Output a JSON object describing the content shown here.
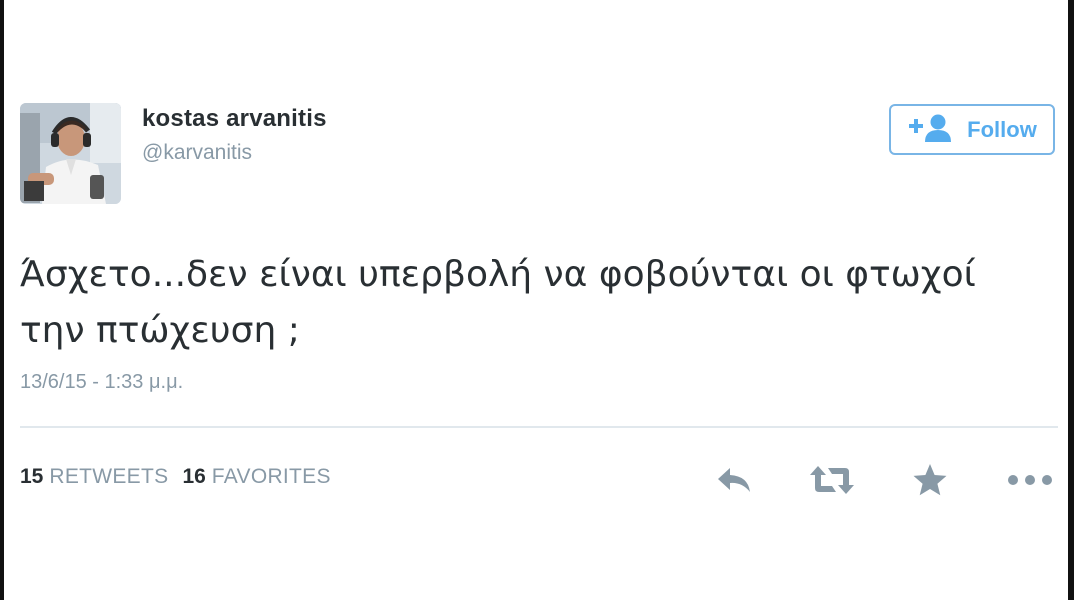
{
  "tweet": {
    "author": {
      "display_name": "kostas arvanitis",
      "handle": "@karvanitis",
      "avatar": "profile-photo"
    },
    "follow_button": {
      "label": "Follow",
      "icon": "follow-person-plus-icon"
    },
    "text_line1": "Άσχετο...δεν είναι υπερβολή να φοβούνται οι φτωχοί",
    "text_line2": "την πτώχευση ;",
    "timestamp": "13/6/15 - 1:33 μ.μ.",
    "stats": {
      "retweets_count": "15",
      "retweets_label": "RETWEETS",
      "favorites_count": "16",
      "favorites_label": "FAVORITES"
    },
    "actions": [
      "reply-icon",
      "retweet-icon",
      "favorite-star-icon",
      "more-dots-icon"
    ]
  },
  "colors": {
    "accent": "#55acee",
    "follow_border": "#79b5e6",
    "text": "#292f33",
    "muted": "#8899a6",
    "action_icon": "#8899a6",
    "divider": "#e1e8ed"
  }
}
